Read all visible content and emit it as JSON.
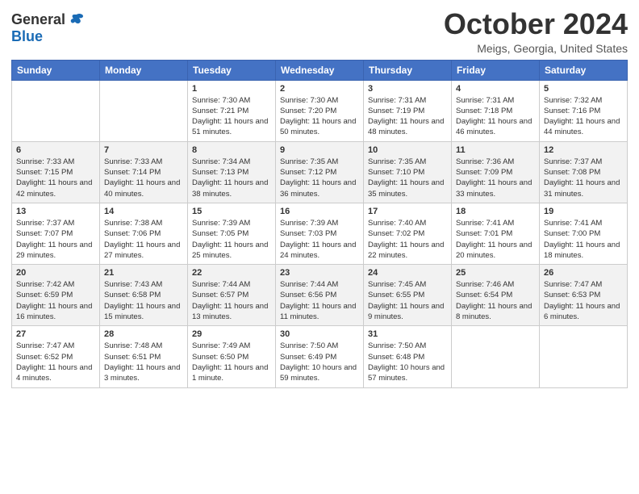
{
  "header": {
    "logo_general": "General",
    "logo_blue": "Blue",
    "title": "October 2024",
    "location": "Meigs, Georgia, United States"
  },
  "days_of_week": [
    "Sunday",
    "Monday",
    "Tuesday",
    "Wednesday",
    "Thursday",
    "Friday",
    "Saturday"
  ],
  "weeks": [
    [
      {
        "day": "",
        "info": ""
      },
      {
        "day": "",
        "info": ""
      },
      {
        "day": "1",
        "info": "Sunrise: 7:30 AM\nSunset: 7:21 PM\nDaylight: 11 hours and 51 minutes."
      },
      {
        "day": "2",
        "info": "Sunrise: 7:30 AM\nSunset: 7:20 PM\nDaylight: 11 hours and 50 minutes."
      },
      {
        "day": "3",
        "info": "Sunrise: 7:31 AM\nSunset: 7:19 PM\nDaylight: 11 hours and 48 minutes."
      },
      {
        "day": "4",
        "info": "Sunrise: 7:31 AM\nSunset: 7:18 PM\nDaylight: 11 hours and 46 minutes."
      },
      {
        "day": "5",
        "info": "Sunrise: 7:32 AM\nSunset: 7:16 PM\nDaylight: 11 hours and 44 minutes."
      }
    ],
    [
      {
        "day": "6",
        "info": "Sunrise: 7:33 AM\nSunset: 7:15 PM\nDaylight: 11 hours and 42 minutes."
      },
      {
        "day": "7",
        "info": "Sunrise: 7:33 AM\nSunset: 7:14 PM\nDaylight: 11 hours and 40 minutes."
      },
      {
        "day": "8",
        "info": "Sunrise: 7:34 AM\nSunset: 7:13 PM\nDaylight: 11 hours and 38 minutes."
      },
      {
        "day": "9",
        "info": "Sunrise: 7:35 AM\nSunset: 7:12 PM\nDaylight: 11 hours and 36 minutes."
      },
      {
        "day": "10",
        "info": "Sunrise: 7:35 AM\nSunset: 7:10 PM\nDaylight: 11 hours and 35 minutes."
      },
      {
        "day": "11",
        "info": "Sunrise: 7:36 AM\nSunset: 7:09 PM\nDaylight: 11 hours and 33 minutes."
      },
      {
        "day": "12",
        "info": "Sunrise: 7:37 AM\nSunset: 7:08 PM\nDaylight: 11 hours and 31 minutes."
      }
    ],
    [
      {
        "day": "13",
        "info": "Sunrise: 7:37 AM\nSunset: 7:07 PM\nDaylight: 11 hours and 29 minutes."
      },
      {
        "day": "14",
        "info": "Sunrise: 7:38 AM\nSunset: 7:06 PM\nDaylight: 11 hours and 27 minutes."
      },
      {
        "day": "15",
        "info": "Sunrise: 7:39 AM\nSunset: 7:05 PM\nDaylight: 11 hours and 25 minutes."
      },
      {
        "day": "16",
        "info": "Sunrise: 7:39 AM\nSunset: 7:03 PM\nDaylight: 11 hours and 24 minutes."
      },
      {
        "day": "17",
        "info": "Sunrise: 7:40 AM\nSunset: 7:02 PM\nDaylight: 11 hours and 22 minutes."
      },
      {
        "day": "18",
        "info": "Sunrise: 7:41 AM\nSunset: 7:01 PM\nDaylight: 11 hours and 20 minutes."
      },
      {
        "day": "19",
        "info": "Sunrise: 7:41 AM\nSunset: 7:00 PM\nDaylight: 11 hours and 18 minutes."
      }
    ],
    [
      {
        "day": "20",
        "info": "Sunrise: 7:42 AM\nSunset: 6:59 PM\nDaylight: 11 hours and 16 minutes."
      },
      {
        "day": "21",
        "info": "Sunrise: 7:43 AM\nSunset: 6:58 PM\nDaylight: 11 hours and 15 minutes."
      },
      {
        "day": "22",
        "info": "Sunrise: 7:44 AM\nSunset: 6:57 PM\nDaylight: 11 hours and 13 minutes."
      },
      {
        "day": "23",
        "info": "Sunrise: 7:44 AM\nSunset: 6:56 PM\nDaylight: 11 hours and 11 minutes."
      },
      {
        "day": "24",
        "info": "Sunrise: 7:45 AM\nSunset: 6:55 PM\nDaylight: 11 hours and 9 minutes."
      },
      {
        "day": "25",
        "info": "Sunrise: 7:46 AM\nSunset: 6:54 PM\nDaylight: 11 hours and 8 minutes."
      },
      {
        "day": "26",
        "info": "Sunrise: 7:47 AM\nSunset: 6:53 PM\nDaylight: 11 hours and 6 minutes."
      }
    ],
    [
      {
        "day": "27",
        "info": "Sunrise: 7:47 AM\nSunset: 6:52 PM\nDaylight: 11 hours and 4 minutes."
      },
      {
        "day": "28",
        "info": "Sunrise: 7:48 AM\nSunset: 6:51 PM\nDaylight: 11 hours and 3 minutes."
      },
      {
        "day": "29",
        "info": "Sunrise: 7:49 AM\nSunset: 6:50 PM\nDaylight: 11 hours and 1 minute."
      },
      {
        "day": "30",
        "info": "Sunrise: 7:50 AM\nSunset: 6:49 PM\nDaylight: 10 hours and 59 minutes."
      },
      {
        "day": "31",
        "info": "Sunrise: 7:50 AM\nSunset: 6:48 PM\nDaylight: 10 hours and 57 minutes."
      },
      {
        "day": "",
        "info": ""
      },
      {
        "day": "",
        "info": ""
      }
    ]
  ]
}
